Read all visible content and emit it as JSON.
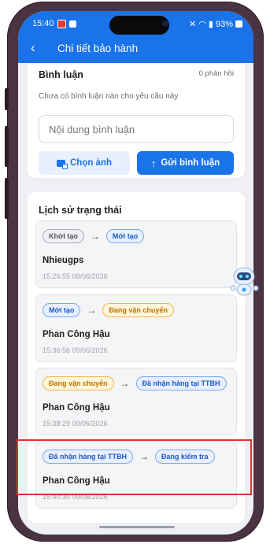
{
  "status": {
    "time": "15:40",
    "battery": "93%"
  },
  "appbar": {
    "back_icon": "‹",
    "title": "Chi tiết bảo hành"
  },
  "comments": {
    "title": "Bình luận",
    "count": "0 phản hồi",
    "empty_text": "Chưa có bình luận nào cho yêu cầu này",
    "input_placeholder": "Nội dung bình luận",
    "choose_image_label": "Chọn ảnh",
    "send_label": "Gửi bình luận"
  },
  "history": {
    "title": "Lịch sử trạng thái",
    "items": [
      {
        "from": "Khởi tạo",
        "to": "Mới tạo",
        "person": "Nhieugps",
        "time": "15:26:55 09/06/2026"
      },
      {
        "from": "Mới tạo",
        "to": "Đang vận chuyển",
        "person": "Phan Công Hậu",
        "time": "15:36:56 09/06/2026"
      },
      {
        "from": "Đang vận chuyển",
        "to": "Đã nhận hàng tại TTBH",
        "person": "Phan Công Hậu",
        "time": "15:38:29 09/06/2026"
      },
      {
        "from": "Đã nhận hàng tại TTBH",
        "to": "Đang kiểm tra",
        "person": "Phan Công Hậu",
        "time": "15:40:30 09/06/2026"
      }
    ]
  },
  "colors": {
    "primary": "#1a73e8",
    "highlight": "#e03030"
  },
  "icons": {
    "back": "chevron-left-icon",
    "image": "image-icon",
    "send": "arrow-up-icon",
    "assistant": "robot-assistant-icon"
  }
}
